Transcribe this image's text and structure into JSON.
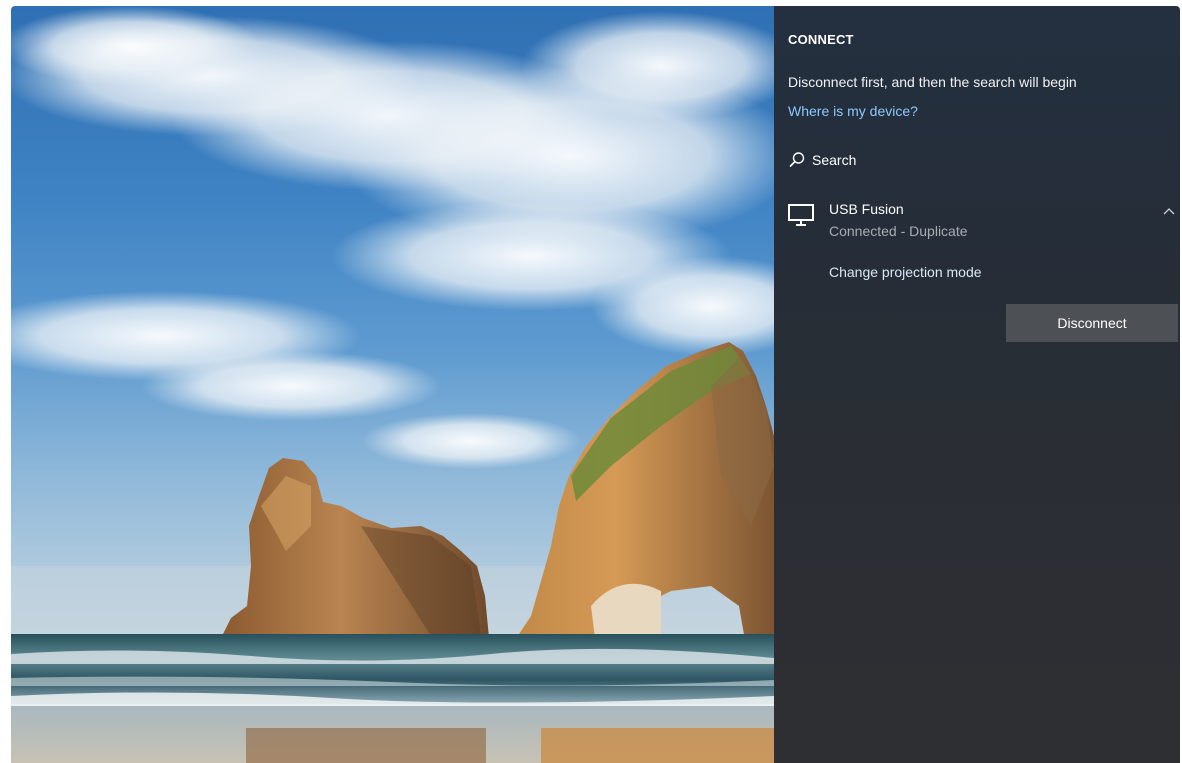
{
  "flyout": {
    "title": "CONNECT",
    "status_text": "Disconnect first, and then the search will begin",
    "help_link": "Where is my device?",
    "search_label": "Search",
    "device": {
      "name": "USB Fusion",
      "state": "Connected - Duplicate",
      "icon": "monitor-icon",
      "expanded": true
    },
    "change_mode_label": "Change projection mode",
    "disconnect_label": "Disconnect"
  },
  "colors": {
    "flyout_background": "#252d38",
    "link": "#8cc8ff",
    "button_background": "#4d5054",
    "secondary_text": "#a8adb3"
  },
  "icons": [
    "search-icon",
    "monitor-icon",
    "chevron-up-icon"
  ]
}
